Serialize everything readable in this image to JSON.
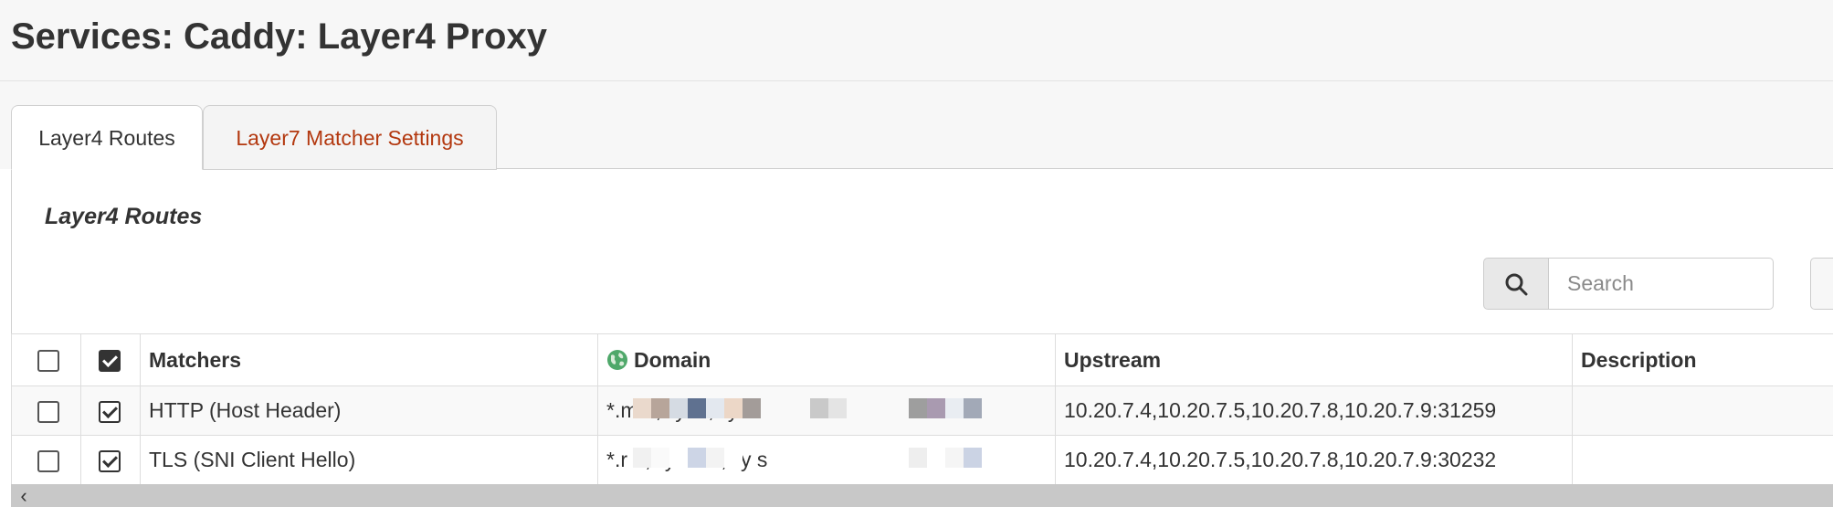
{
  "header": {
    "title": "Services: Caddy: Layer4 Proxy"
  },
  "tabs": [
    {
      "label": "Layer4 Routes",
      "active": true
    },
    {
      "label": "Layer7 Matcher Settings",
      "active": false
    }
  ],
  "section": {
    "title": "Layer4 Routes"
  },
  "search": {
    "icon": "search-icon",
    "placeholder": "Search",
    "value": ""
  },
  "table": {
    "columns": {
      "matchers": "Matchers",
      "domain": "Domain",
      "upstream": "Upstream",
      "description": "Description"
    },
    "rows": [
      {
        "selected": false,
        "enabled": true,
        "matchers": "HTTP (Host Header)",
        "domain": "*.m                n,*.y        ai,*.y            s",
        "upstream": "10.20.7.4,10.20.7.5,10.20.7.8,10.20.7.9:31259",
        "description": ""
      },
      {
        "selected": false,
        "enabled": true,
        "matchers": "TLS (SNI Client Hello)",
        "domain": "*.r                n,*.yoo  ai,*.y            s",
        "upstream": "10.20.7.4,10.20.7.5,10.20.7.8,10.20.7.9:30232",
        "description": ""
      }
    ]
  },
  "colors": {
    "accent_tab_text": "#b3380f",
    "header_bg": "#f7f7f7",
    "scrollbar": "#c8c8c8"
  },
  "scrollbar": {
    "left_arrow": "‹"
  }
}
